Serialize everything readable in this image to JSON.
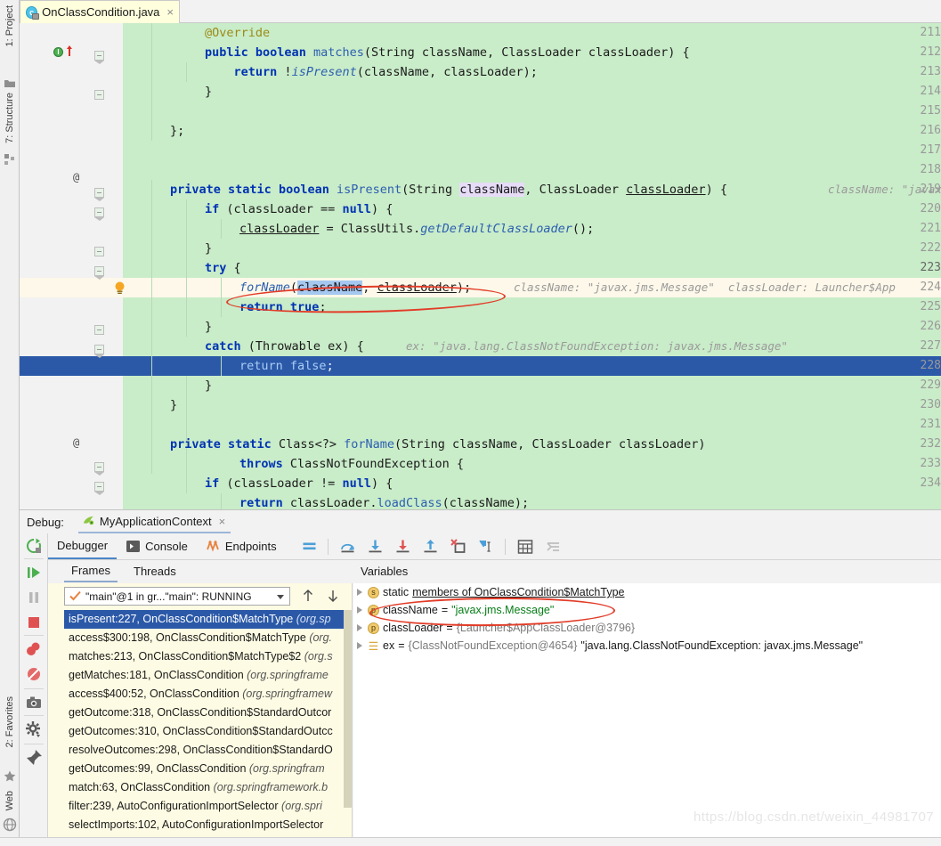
{
  "left_strip": {
    "tabs": [
      {
        "label": "1: Project",
        "icon": "project-folder-icon"
      },
      {
        "label": "7: Structure",
        "icon": "structure-icon"
      }
    ],
    "bottom_tabs": [
      {
        "label": "2: Favorites",
        "icon": "star-icon"
      },
      {
        "label": "Web",
        "icon": "globe-icon"
      }
    ]
  },
  "editor_tab": {
    "filename": "OnClassCondition.java",
    "icon": "java-class-icon",
    "close": "×"
  },
  "editor": {
    "first_line": 211,
    "current_line": 223,
    "selected_line": 227,
    "lines": [
      {
        "n": 211,
        "code": "    @Override",
        "hint": ""
      },
      {
        "n": 212,
        "code": "    public boolean matches(String className, ClassLoader classLoader) {",
        "hint": ""
      },
      {
        "n": 213,
        "code": "        return !isPresent(className, classLoader);",
        "hint": ""
      },
      {
        "n": 214,
        "code": "    }",
        "hint": ""
      },
      {
        "n": 215,
        "code": "",
        "hint": ""
      },
      {
        "n": 216,
        "code": "};",
        "hint": ""
      },
      {
        "n": 217,
        "code": "",
        "hint": ""
      },
      {
        "n": 218,
        "code": "private static boolean isPresent(String className, ClassLoader classLoader) {",
        "hint": "className: \"javax.jm"
      },
      {
        "n": 219,
        "code": "    if (classLoader == null) {",
        "hint": ""
      },
      {
        "n": 220,
        "code": "        classLoader = ClassUtils.getDefaultClassLoader();",
        "hint": ""
      },
      {
        "n": 221,
        "code": "    }",
        "hint": ""
      },
      {
        "n": 222,
        "code": "    try {",
        "hint": ""
      },
      {
        "n": 223,
        "code": "        forName(className, classLoader);",
        "hint": "className: \"javax.jms.Message\"  classLoader: Launcher$App"
      },
      {
        "n": 224,
        "code": "        return true;",
        "hint": ""
      },
      {
        "n": 225,
        "code": "    }",
        "hint": ""
      },
      {
        "n": 226,
        "code": "    catch (Throwable ex) {",
        "hint": "ex: \"java.lang.ClassNotFoundException: javax.jms.Message\""
      },
      {
        "n": 227,
        "code": "        return false;",
        "hint": ""
      },
      {
        "n": 228,
        "code": "    }",
        "hint": ""
      },
      {
        "n": 229,
        "code": "}",
        "hint": ""
      },
      {
        "n": 230,
        "code": "",
        "hint": ""
      },
      {
        "n": 231,
        "code": "private static Class<?> forName(String className, ClassLoader classLoader)",
        "hint": ""
      },
      {
        "n": 232,
        "code": "        throws ClassNotFoundException {",
        "hint": ""
      },
      {
        "n": 233,
        "code": "    if (classLoader != null) {",
        "hint": ""
      },
      {
        "n": 234,
        "code": "        return classLoader.loadClass(className);",
        "hint": ""
      }
    ],
    "gutter_icons": {
      "line_212": "breakpoint-method-icon",
      "line_218": "at-annotation-marker",
      "line_223": "intention-bulb-icon",
      "line_231": "at-annotation-marker"
    }
  },
  "debug": {
    "label": "Debug:",
    "session_name": "MyApplicationContext",
    "session_icon": "spring-boot-icon",
    "session_close": "×",
    "toolbar_tabs": [
      {
        "label": "Debugger",
        "icon": "debugger-icon",
        "active": true
      },
      {
        "label": "Console",
        "icon": "console-icon",
        "active": false
      },
      {
        "label": "Endpoints",
        "icon": "endpoints-icon",
        "active": false
      }
    ],
    "step_buttons": [
      "show-execution-point-icon",
      "step-over-icon",
      "step-into-icon",
      "force-step-into-icon",
      "step-out-icon",
      "drop-frame-icon",
      "run-to-cursor-icon",
      "evaluate-expression-icon",
      "mute-breakpoints-icon"
    ],
    "rail_buttons": [
      "rerun-icon",
      "resume-program-icon",
      "pause-program-icon",
      "stop-icon",
      "view-breakpoints-icon",
      "mute-breakpoints-icon",
      "get-thread-dump-icon",
      "settings-icon",
      "pin-tab-icon"
    ],
    "panes": {
      "frames_tab": "Frames",
      "threads_tab": "Threads",
      "variables_tab": "Variables"
    },
    "thread_selector": {
      "value": "\"main\"@1 in gr...\"main\": RUNNING",
      "check_icon": "check-icon",
      "up_icon": "arrow-up-icon",
      "down_icon": "arrow-down-icon"
    },
    "frames": [
      {
        "method": "isPresent:227, ",
        "cls": "OnClassCondition$MatchType ",
        "pkg": "(org.sp",
        "selected": true
      },
      {
        "method": "access$300:198, ",
        "cls": "OnClassCondition$MatchType ",
        "pkg": "(org.",
        "selected": false
      },
      {
        "method": "matches:213, ",
        "cls": "OnClassCondition$MatchType$2 ",
        "pkg": "(org.s",
        "selected": false
      },
      {
        "method": "getMatches:181, ",
        "cls": "OnClassCondition ",
        "pkg": "(org.springframe",
        "selected": false
      },
      {
        "method": "access$400:52, ",
        "cls": "OnClassCondition ",
        "pkg": "(org.springframew",
        "selected": false
      },
      {
        "method": "getOutcome:318, ",
        "cls": "OnClassCondition$StandardOutcor",
        "pkg": "",
        "selected": false
      },
      {
        "method": "getOutcomes:310, ",
        "cls": "OnClassCondition$StandardOutcc",
        "pkg": "",
        "selected": false
      },
      {
        "method": "resolveOutcomes:298, ",
        "cls": "OnClassCondition$StandardO",
        "pkg": "",
        "selected": false
      },
      {
        "method": "getOutcomes:99, ",
        "cls": "OnClassCondition ",
        "pkg": "(org.springfram",
        "selected": false
      },
      {
        "method": "match:63, ",
        "cls": "OnClassCondition ",
        "pkg": "(org.springframework.b",
        "selected": false
      },
      {
        "method": "filter:239, ",
        "cls": "AutoConfigurationImportSelector ",
        "pkg": "(org.spri",
        "selected": false
      },
      {
        "method": "selectImports:102, ",
        "cls": "AutoConfigurationImportSelector",
        "pkg": "",
        "selected": false
      }
    ],
    "variables": [
      {
        "badge": "s",
        "badge_type": "static",
        "name": "static",
        "name_underlined": " members of OnClassCondition$MatchType",
        "eq": "",
        "value": "",
        "value_type": "none",
        "highlighted": false
      },
      {
        "badge": "p",
        "badge_type": "field",
        "name": "className",
        "name_underlined": "",
        "eq": " = ",
        "value": "\"javax.jms.Message\"",
        "value_type": "string",
        "highlighted": true
      },
      {
        "badge": "p",
        "badge_type": "field",
        "name": "classLoader",
        "name_underlined": "",
        "eq": " = ",
        "value": "{Launcher$AppClassLoader@3796}",
        "value_type": "ref",
        "highlighted": false
      },
      {
        "badge": "☰",
        "badge_type": "list",
        "name": "ex",
        "name_underlined": "",
        "eq": " = ",
        "value": "{ClassNotFoundException@4654}",
        "value_extra": "\"java.lang.ClassNotFoundException: javax.jms.Message\"",
        "value_type": "ref",
        "highlighted": false
      }
    ]
  },
  "watermark": "https://blog.csdn.net/weixin_44981707",
  "colors": {
    "editor_bg": "#c9ecc9",
    "gutter_bg": "#f2f2f2",
    "current_line": "#fdf8e9",
    "selection": "#2b59a8",
    "keyword": "#0033b3",
    "method": "#2c5fb0",
    "annotation": "#9a8b17",
    "hint_gray": "#9a9a9a",
    "annot_ellipse": "#e23c28",
    "frames_bg": "#fdfbe3",
    "string_green": "#067d17"
  }
}
